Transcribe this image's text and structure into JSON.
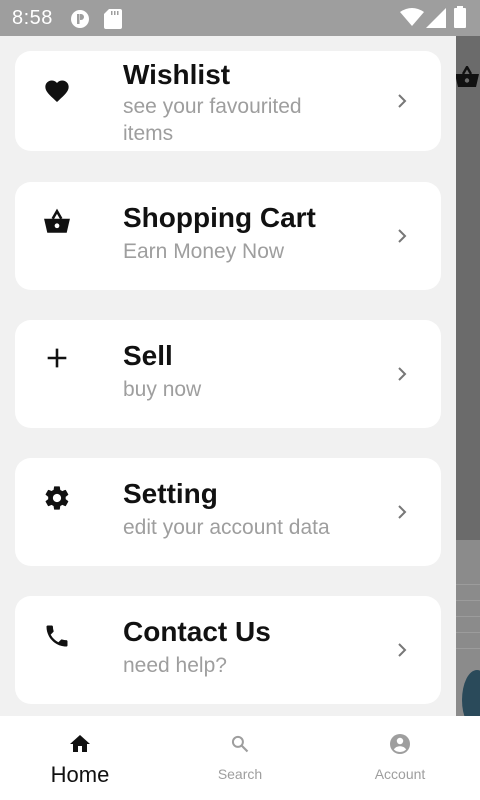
{
  "status_bar": {
    "time": "8:58"
  },
  "menu": {
    "items": [
      {
        "icon": "heart-icon",
        "title": "Wishlist",
        "subtitle": "see your favourited items"
      },
      {
        "icon": "shopping-basket-icon",
        "title": "Shopping Cart",
        "subtitle": "Earn Money Now"
      },
      {
        "icon": "plus-icon",
        "title": "Sell",
        "subtitle": "buy now"
      },
      {
        "icon": "gear-icon",
        "title": "Setting",
        "subtitle": "edit your account data"
      },
      {
        "icon": "phone-icon",
        "title": "Contact Us",
        "subtitle": "need help?"
      }
    ]
  },
  "bottom_nav": {
    "items": [
      {
        "icon": "home-icon",
        "label": "Home",
        "active": true
      },
      {
        "icon": "search-icon",
        "label": "Search",
        "active": false
      },
      {
        "icon": "account-icon",
        "label": "Account",
        "active": false
      }
    ]
  }
}
